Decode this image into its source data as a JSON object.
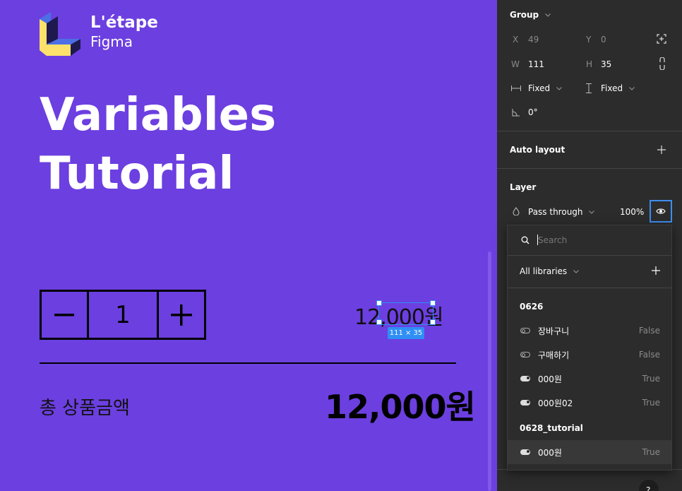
{
  "canvas": {
    "logo": {
      "brand": "L'étape",
      "sub": "Figma"
    },
    "hero": {
      "line1": "Variables",
      "line2": "Tutorial"
    },
    "stepper": {
      "minus": "−",
      "quantity": "1",
      "plus": "+"
    },
    "selected_price": "12,000원",
    "selection_size": "111 × 35",
    "total_label": "총 상품금액",
    "total_value": "12,000원"
  },
  "panel": {
    "group": {
      "title": "Group"
    },
    "position": {
      "x_label": "X",
      "x_value": "49",
      "y_label": "Y",
      "y_value": "0"
    },
    "size": {
      "w_label": "W",
      "w_value": "111",
      "h_label": "H",
      "h_value": "35"
    },
    "resizing": {
      "horizontal": "Fixed",
      "vertical": "Fixed"
    },
    "rotation": {
      "value": "0°"
    },
    "auto_layout": {
      "title": "Auto layout"
    },
    "layer": {
      "title": "Layer",
      "blend_mode": "Pass through",
      "opacity": "100%"
    }
  },
  "variables_dropdown": {
    "search": {
      "placeholder": "Search"
    },
    "library_filter": "All libraries",
    "groups": [
      {
        "name": "0626",
        "items": [
          {
            "name": "장바구니",
            "value": "False",
            "state": "off"
          },
          {
            "name": "구매하기",
            "value": "False",
            "state": "off"
          },
          {
            "name": "000원",
            "value": "True",
            "state": "on"
          },
          {
            "name": "000원02",
            "value": "True",
            "state": "on"
          }
        ]
      },
      {
        "name": "0628_tutorial",
        "items": [
          {
            "name": "000원",
            "value": "True",
            "state": "on"
          }
        ]
      }
    ]
  },
  "colors": {
    "canvas_bg": "#6c3fe0",
    "panel_bg": "#2c2c2c",
    "accent": "#2f8ff5",
    "logo_yellow": "#fce26a",
    "logo_navy": "#1e1a4f"
  }
}
